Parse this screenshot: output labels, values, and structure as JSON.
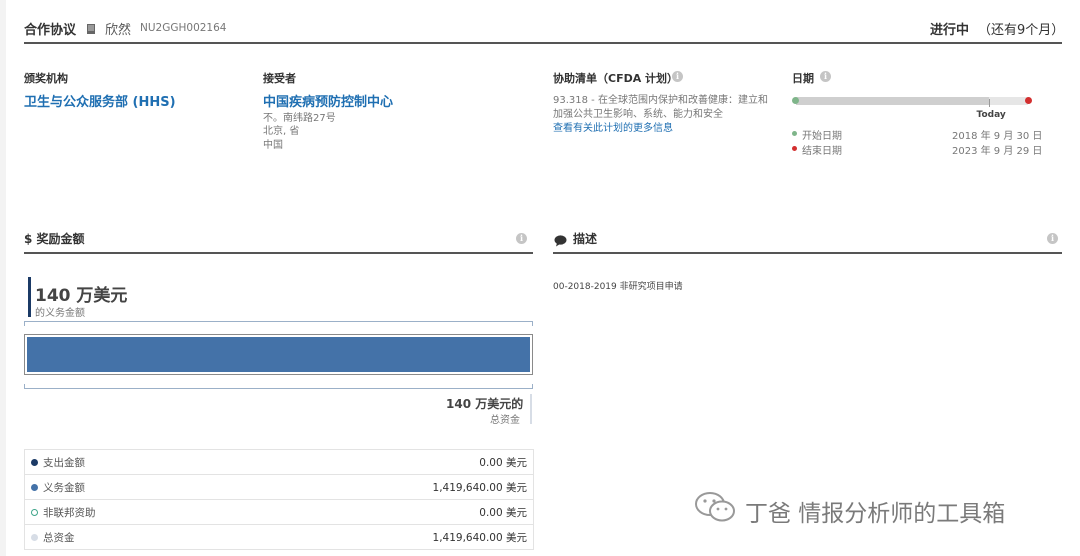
{
  "header": {
    "title": "合作协议",
    "recipient_short": "欣然",
    "award_id": "NU2GGH002164",
    "status": "进行中",
    "remaining": "（还有9个月）"
  },
  "funding_agency": {
    "label": "颁奖机构",
    "name": "卫生与公众服务部 (HHS)"
  },
  "recipient": {
    "label": "接受者",
    "name": "中国疾病预防控制中心",
    "address1": "不。南纬路27号",
    "address2": "北京, 省",
    "address3": "中国"
  },
  "cfda": {
    "label": "协助清单（CFDA 计划）",
    "line1": "93.318 - 在全球范围内保护和改善健康：建立和",
    "line2": "加强公共卫生影响、系统、能力和安全",
    "link": "查看有关此计划的更多信息"
  },
  "dates": {
    "label": "日期",
    "today": "Today",
    "start_label": "开始日期",
    "start_value": "2018 年 9 月 30 日",
    "end_label": "结束日期",
    "end_value": "2023 年 9 月 29 日",
    "today_fraction": 0.83,
    "colors": {
      "start": "#7fb58a",
      "end": "#d32f2f"
    }
  },
  "award_amount": {
    "title": "$ 奖励金额",
    "obligated_value": "140 万美元",
    "obligated_label": "的义务金额",
    "total_value": "140 万美元的",
    "total_label": "总资金",
    "obligated_fraction": 1.0,
    "bar_color": "#4472a8"
  },
  "description": {
    "title": "描述",
    "text": "00-2018-2019 非研究项目申请"
  },
  "breakdown": [
    {
      "label": "支出金额",
      "value": "0.00 美元",
      "color": "#1b3a66",
      "hollow": false
    },
    {
      "label": "义务金额",
      "value": "1,419,640.00 美元",
      "color": "#4472a8",
      "hollow": false
    },
    {
      "label": "非联邦资助",
      "value": "0.00 美元",
      "color": "#3fa58a",
      "hollow": true
    },
    {
      "label": "总资金",
      "value": "1,419,640.00 美元",
      "color": "#d7dde6",
      "hollow": false
    }
  ],
  "watermark": {
    "text": "丁爸 情报分析师的工具箱"
  }
}
